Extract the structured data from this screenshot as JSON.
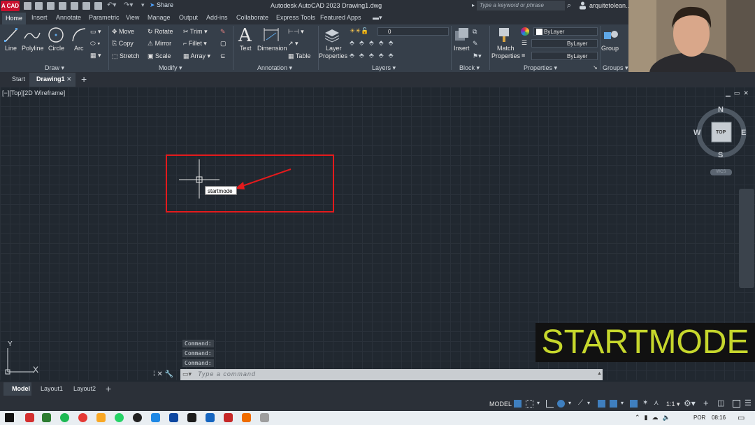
{
  "titlebar": {
    "app_badge": "A CAD",
    "share_label": "Share",
    "title": "Autodesk AutoCAD 2023    Drawing1.dwg",
    "search_placeholder": "Type a keyword or phrase",
    "user_name": "arquitetolean..."
  },
  "ribbon_tabs": [
    "Home",
    "Insert",
    "Annotate",
    "Parametric",
    "View",
    "Manage",
    "Output",
    "Add-ins",
    "Collaborate",
    "Express Tools",
    "Featured Apps"
  ],
  "ribbon": {
    "draw": {
      "title": "Draw",
      "line": "Line",
      "polyline": "Polyline",
      "circle": "Circle",
      "arc": "Arc"
    },
    "modify": {
      "title": "Modify",
      "move": "Move",
      "rotate": "Rotate",
      "trim": "Trim",
      "copy": "Copy",
      "mirror": "Mirror",
      "fillet": "Fillet",
      "stretch": "Stretch",
      "scale": "Scale",
      "array": "Array"
    },
    "annotation": {
      "title": "Annotation",
      "text": "Text",
      "dimension": "Dimension",
      "table": "Table"
    },
    "layers": {
      "title": "Layers",
      "layer_properties_1": "Layer",
      "layer_properties_2": "Properties",
      "current_layer": "0"
    },
    "block": {
      "title": "Block",
      "insert": "Insert"
    },
    "properties": {
      "title": "Properties",
      "match_1": "Match",
      "match_2": "Properties",
      "color": "ByLayer",
      "linetype": "ByLayer",
      "lineweight": "ByLayer"
    },
    "groups": {
      "title": "Groups",
      "group": "Group"
    }
  },
  "doc_tabs": {
    "start": "Start",
    "drawing": "Drawing1"
  },
  "viewport": {
    "label": "[−][Top][2D Wireframe]",
    "dynamic_input": "startmode",
    "viewcube": {
      "top": "TOP",
      "n": "N",
      "s": "S",
      "e": "E",
      "w": "W",
      "wcs": "WCS"
    },
    "ucs_x": "X",
    "ucs_y": "Y"
  },
  "command": {
    "history": [
      "Command:",
      "Command:",
      "Command:"
    ],
    "placeholder": "Type a command"
  },
  "caption": "STARTMODE",
  "layout_tabs": [
    "Model",
    "Layout1",
    "Layout2"
  ],
  "status": {
    "model": "MODEL",
    "scale": "1:1"
  },
  "tray": {
    "lang": "POR",
    "time": "08:16"
  },
  "colors": {
    "highlight": "#e41a1c",
    "caption_text": "#c6d72c",
    "canvas": "#212830",
    "ribbon": "#363f4a"
  }
}
